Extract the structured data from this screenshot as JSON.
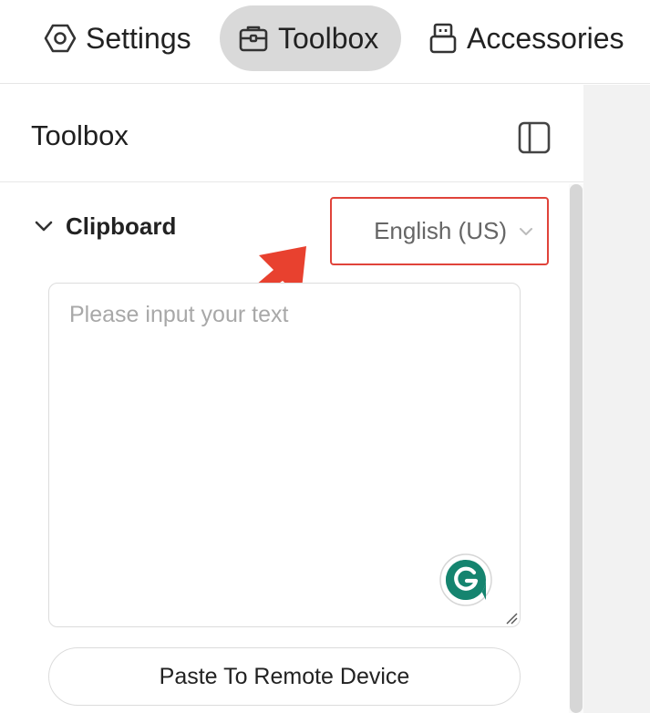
{
  "nav": {
    "tabs": [
      {
        "label": "Settings",
        "icon": "gear-icon",
        "active": false
      },
      {
        "label": "Toolbox",
        "icon": "toolbox-icon",
        "active": true
      },
      {
        "label": "Accessories",
        "icon": "usb-icon",
        "active": false
      }
    ]
  },
  "panel": {
    "title": "Toolbox",
    "toggle_icon": "sidebar-toggle-icon"
  },
  "clipboard": {
    "section_title": "Clipboard",
    "expanded": true,
    "language": "English (US)",
    "placeholder": "Please input your text",
    "value": "",
    "paste_label": "Paste To Remote Device"
  },
  "colors": {
    "active_tab_bg": "#d9d9d9",
    "highlight_border": "#e0433a",
    "arrow": "#e8412f",
    "grammarly": "#15846f"
  }
}
